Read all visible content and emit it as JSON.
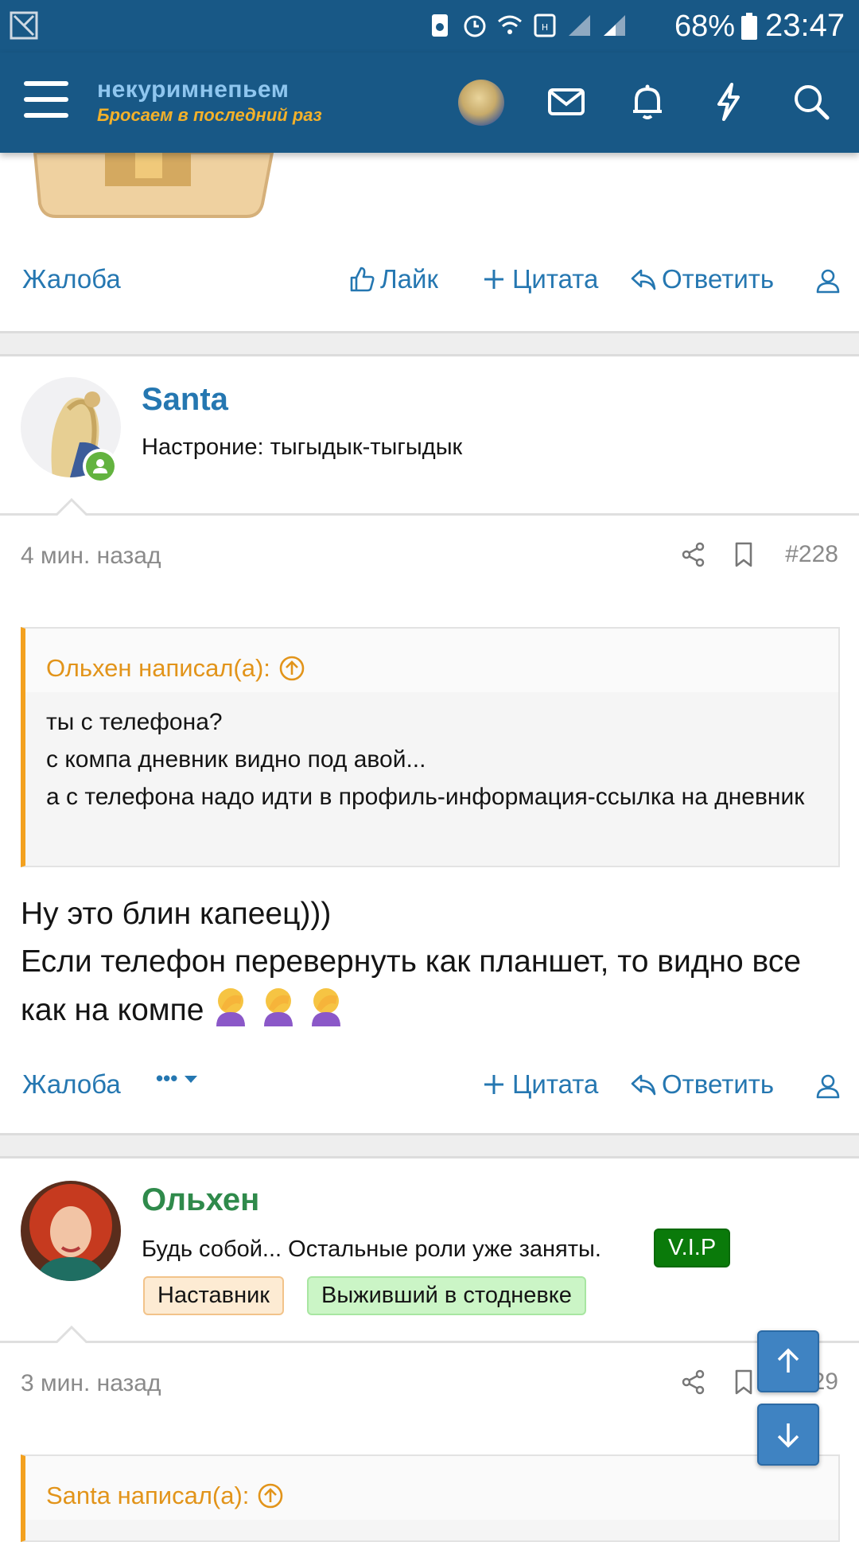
{
  "status_bar": {
    "battery": "68%",
    "time": "23:47",
    "icons": [
      "sim-icon",
      "alarm-icon",
      "wifi-icon",
      "hd-icon",
      "signal-icon",
      "signal-icon",
      "battery-icon"
    ]
  },
  "header": {
    "logo_line1": "некуримнепьем",
    "logo_line2": "Бросаем в последний раз",
    "icons": [
      "menu-icon",
      "avatar",
      "mail-icon",
      "bell-icon",
      "lightning-icon",
      "search-icon"
    ]
  },
  "post_prev": {
    "actions": {
      "report": "Жалоба",
      "like": "Лайк",
      "quote": "Цитата",
      "reply": "Ответить"
    }
  },
  "post_228": {
    "author": "Santa",
    "user_title": "Настроние: тыгыдык-тыгыдык",
    "time_ago": "4 мин. назад",
    "post_number": "#228",
    "quote": {
      "author_line": "Ольхен написал(а):",
      "lines": [
        "ты с телефона?",
        "с компа дневник видно под авой...",
        "а с телефона надо идти в профиль-информация-ссылка на дневник"
      ]
    },
    "text_line1": "Ну это блин капеец)))",
    "text_line2": "Если телефон перевернуть как планшет, то видно все как на компе",
    "emoji_count": 3,
    "actions": {
      "report": "Жалоба",
      "more": "•••",
      "quote": "Цитата",
      "reply": "Ответить"
    }
  },
  "post_229": {
    "author": "Ольхен",
    "user_title": "Будь собой... Остальные роли уже заняты.",
    "badges": {
      "vip": "V.I.P",
      "mentor": "Наставник",
      "survivor": "Выживший в стодневке"
    },
    "time_ago": "3 мин. назад",
    "post_number": "#229",
    "quote_author_line": "Santa написал(а):"
  },
  "colors": {
    "header_bg": "#185886",
    "link": "#2577b1",
    "quote_accent": "#f3a11f",
    "author_green": "#2f8a4b",
    "vip_bg": "#0a7a0a"
  }
}
